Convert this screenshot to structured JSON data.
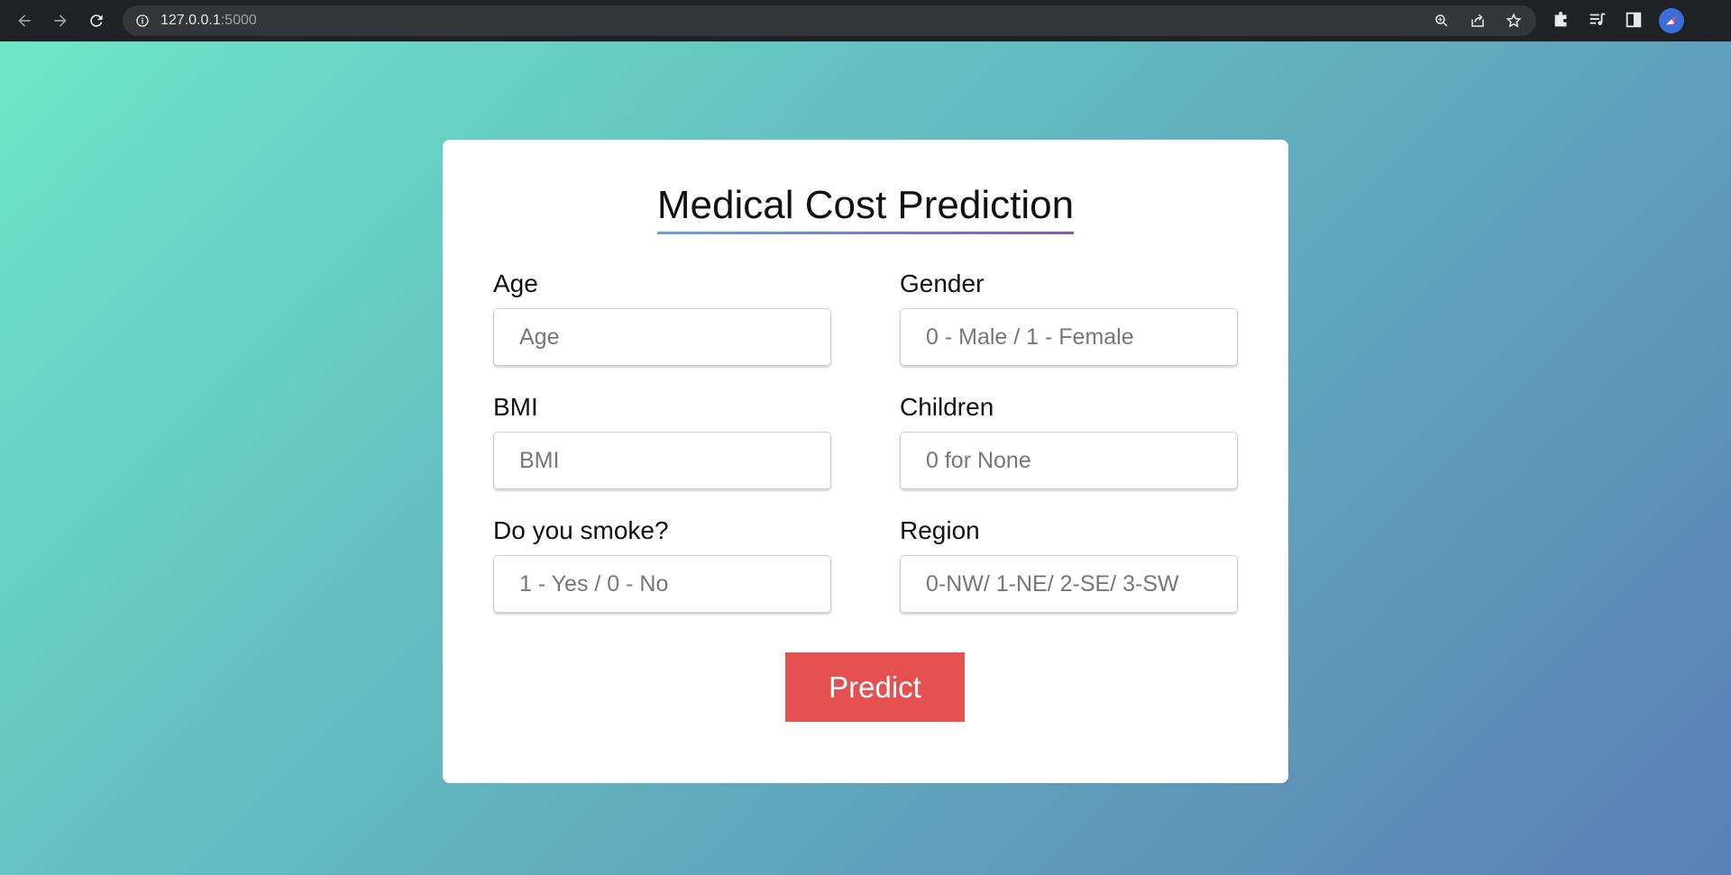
{
  "browser": {
    "url_host": "127.0.0.1",
    "url_port": ":5000"
  },
  "page": {
    "title": "Medical Cost Prediction",
    "fields": [
      {
        "label": "Age",
        "placeholder": "Age",
        "value": ""
      },
      {
        "label": "Gender",
        "placeholder": "0 - Male / 1 - Female",
        "value": ""
      },
      {
        "label": "BMI",
        "placeholder": "BMI",
        "value": ""
      },
      {
        "label": "Children",
        "placeholder": "0 for None",
        "value": ""
      },
      {
        "label": "Do you smoke?",
        "placeholder": "1 - Yes / 0 - No",
        "value": ""
      },
      {
        "label": "Region",
        "placeholder": "0-NW/ 1-NE/ 2-SE/ 3-SW",
        "value": ""
      }
    ],
    "predict_label": "Predict"
  },
  "colors": {
    "predict_button": "#e55050",
    "gradient_start": "#6ee6c8",
    "gradient_end": "#5b7fb4"
  }
}
